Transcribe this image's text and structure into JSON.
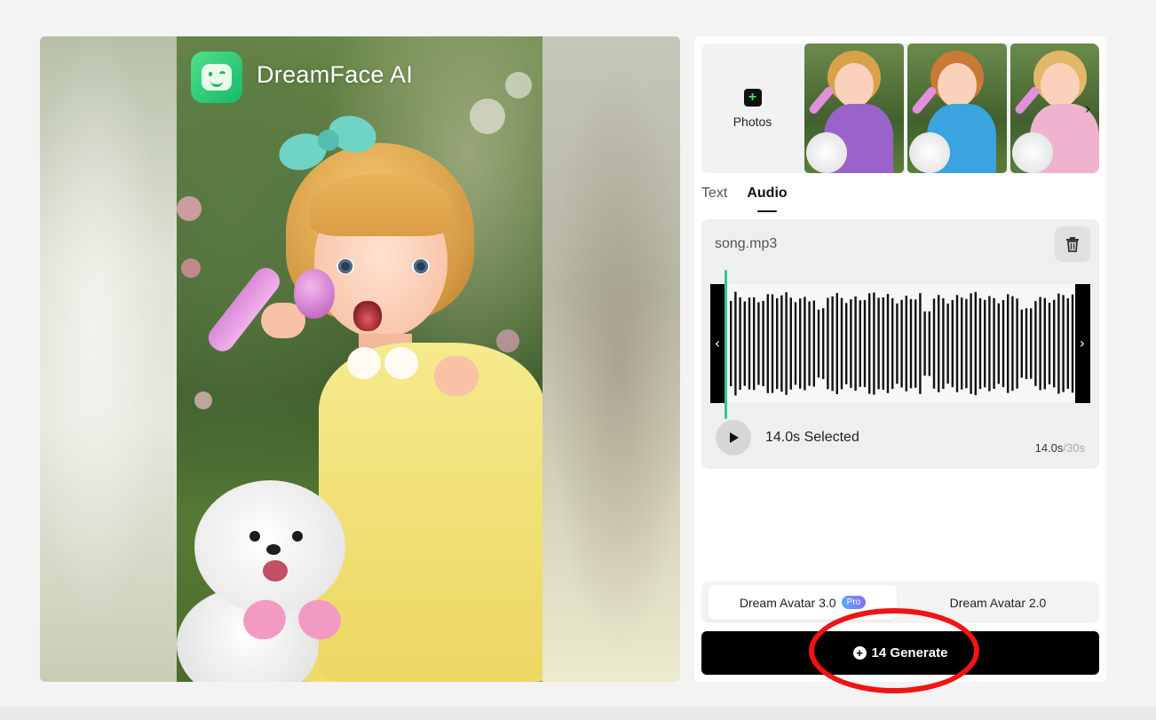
{
  "brand": {
    "name": "DreamFace AI"
  },
  "photos": {
    "add_label": "Photos",
    "thumbnails": [
      {
        "name": "purple-dress",
        "dress_color": "#9a63c9",
        "hair_color": "#d9a24a"
      },
      {
        "name": "blue-dress",
        "dress_color": "#3aa3e0",
        "hair_color": "#c87a36"
      },
      {
        "name": "pink-dress",
        "dress_color": "#f0b3cf",
        "hair_color": "#e3b768"
      }
    ]
  },
  "tabs": [
    {
      "label": "Text",
      "active": false
    },
    {
      "label": "Audio",
      "active": true
    }
  ],
  "audio": {
    "file_name": "song.mp3",
    "selected_label": "14.0s Selected",
    "duration_current": "14.0s",
    "duration_max": "/30s",
    "selection_fraction": 0.467
  },
  "models": [
    {
      "label": "Dream Avatar 3.0",
      "badge": "Pro",
      "active": true
    },
    {
      "label": "Dream Avatar 2.0",
      "active": false
    }
  ],
  "generate": {
    "label": "14 Generate"
  },
  "colors": {
    "accent_green": "#3ee05a",
    "highlight_red": "#f01414",
    "playhead": "#2fc88f"
  }
}
